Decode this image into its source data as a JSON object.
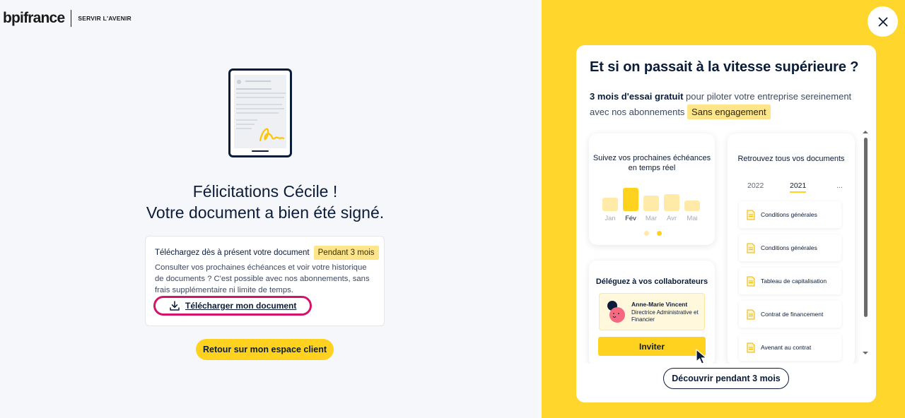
{
  "brand": {
    "name": "bpifrance",
    "tagline": "SERVIR L'AVENIR"
  },
  "confirmation": {
    "title_line1": "Félicitations Cécile !",
    "title_line2": "Votre document a bien été signé."
  },
  "download_card": {
    "heading": "Téléchargez dès à présent votre document",
    "badge": "Pendant 3 mois",
    "body": "Consulter vos prochaines échéances et voir votre historique de documents ? C'est possible avec nos abonnements, sans frais supplémentaire ni limite de temps.",
    "link_label": "Télécharger mon document"
  },
  "back_button_label": "Retour sur mon espace client",
  "promo": {
    "title": "Et si on passait à la vitesse supérieure ?",
    "text_bold": "3 mois d'essai gratuit",
    "text_rest": " pour piloter votre entreprise sereinement avec nos abonnements ",
    "text_tag": "Sans engagement",
    "chart_card": {
      "title": "Suivez vos prochaines échéances en temps réel",
      "months": [
        "Jan",
        "Fév",
        "Mar",
        "Avr",
        "Mai"
      ],
      "active_month": "Fév"
    },
    "team_card": {
      "title": "Déléguez à vos collaborateurs",
      "contact_name": "Anne-Marie Vincent",
      "contact_role": "Directrice Administrative et Financier",
      "invite_label": "Inviter"
    },
    "docs_card": {
      "title": "Retrouvez tous vos documents",
      "years": [
        "2022",
        "2021",
        "..."
      ],
      "active_year": "2021",
      "documents": [
        "Conditions générales",
        "Conditions générales",
        "Tableau de capitalisation",
        "Contrat de financement",
        "Avenant au contrat"
      ]
    },
    "discover_label": "Découvrir pendant 3 mois"
  },
  "colors": {
    "accent_yellow": "#ffd21f",
    "navy": "#0b1c3a",
    "highlight_pink": "#d4136a"
  },
  "icons": {
    "close": "close-icon",
    "download": "download-icon",
    "document": "document-icon"
  }
}
